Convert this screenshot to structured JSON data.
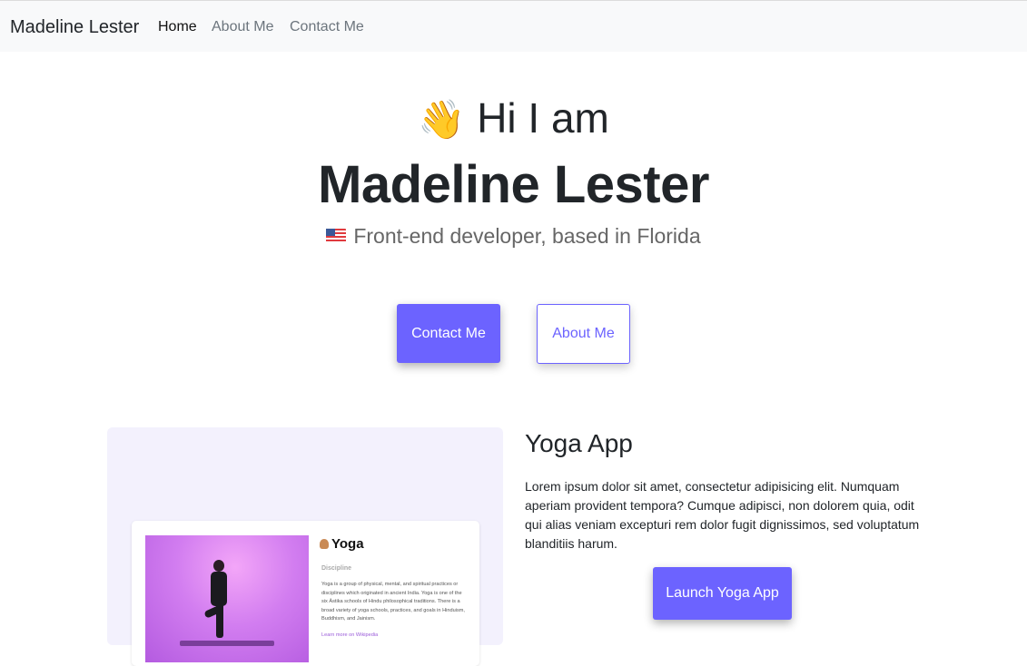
{
  "navbar": {
    "brand": "Madeline Lester",
    "links": [
      {
        "label": "Home",
        "active": true
      },
      {
        "label": "About Me",
        "active": false
      },
      {
        "label": "Contact Me",
        "active": false
      }
    ]
  },
  "hero": {
    "greeting": "Hi I am",
    "name": "Madeline Lester",
    "subtitle": "Front-end developer, based in Florida"
  },
  "buttons": {
    "contact": "Contact Me",
    "about": "About Me"
  },
  "project": {
    "title": "Yoga App",
    "description": "Lorem ipsum dolor sit amet, consectetur adipisicing elit. Numquam aperiam provident tempora? Cumque adipisci, non dolorem quia, odit qui alias veniam excepturi rem dolor fugit dignissimos, sed voluptatum blanditiis harum.",
    "launch_label": "Launch Yoga App",
    "preview": {
      "title": "Yoga",
      "label": "Discipline",
      "text": "Yoga is a group of physical, mental, and spiritual practices or disciplines which originated in ancient India. Yoga is one of the six Āstika schools of Hindu philosophical traditions. There is a broad variety of yoga schools, practices, and goals in Hinduism, Buddhism, and Jainism.",
      "link": "Learn more on Wikipedia"
    }
  },
  "colors": {
    "accent": "#6c63ff",
    "navbar_bg": "#f8f9fa",
    "panel_bg": "#f3f1fd"
  }
}
